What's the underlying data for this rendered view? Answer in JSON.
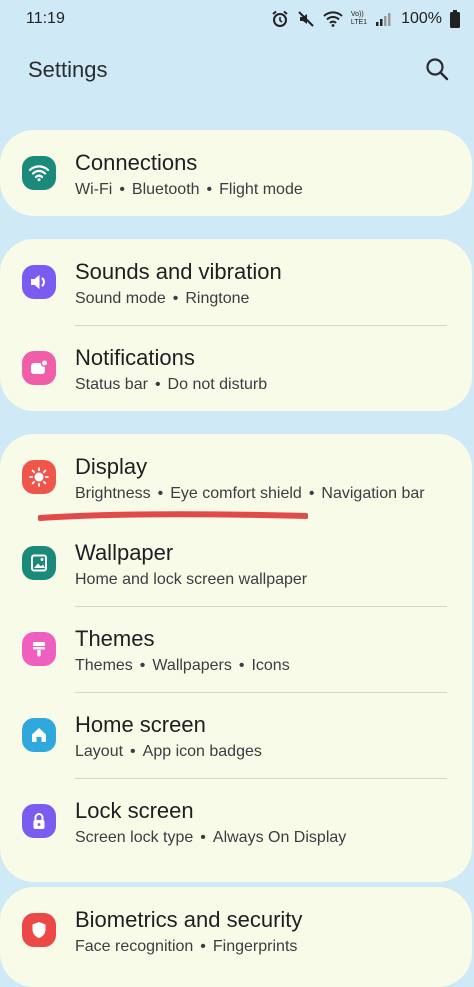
{
  "status_bar": {
    "time": "11:19",
    "battery": "100%",
    "icons": [
      "alarm-icon",
      "mute-icon",
      "wifi-icon",
      "volte-icon",
      "signal-icon",
      "battery-icon"
    ],
    "volte_label": "Vo))",
    "lte_label": "LTE1"
  },
  "header": {
    "title": "Settings",
    "search_icon": "search-icon"
  },
  "groups": [
    {
      "items": [
        {
          "title": "Connections",
          "subtitle": [
            "Wi-Fi",
            "Bluetooth",
            "Flight mode"
          ],
          "icon": "wifi-icon",
          "color": "#1b8a7a"
        }
      ]
    },
    {
      "items": [
        {
          "title": "Sounds and vibration",
          "subtitle": [
            "Sound mode",
            "Ringtone"
          ],
          "icon": "speaker-icon",
          "color": "#7b5cf0"
        },
        {
          "title": "Notifications",
          "subtitle": [
            "Status bar",
            "Do not disturb"
          ],
          "icon": "notification-icon",
          "color": "#f05ea8"
        }
      ]
    },
    {
      "items": [
        {
          "title": "Display",
          "subtitle": [
            "Brightness",
            "Eye comfort shield",
            "Navigation bar"
          ],
          "icon": "sun-icon",
          "color": "#f0554c"
        },
        {
          "title": "Wallpaper",
          "subtitle": [
            "Home and lock screen wallpaper"
          ],
          "icon": "image-icon",
          "color": "#1b8a7a"
        },
        {
          "title": "Themes",
          "subtitle": [
            "Themes",
            "Wallpapers",
            "Icons"
          ],
          "icon": "brush-icon",
          "color": "#ee5fc0"
        },
        {
          "title": "Home screen",
          "subtitle": [
            "Layout",
            "App icon badges"
          ],
          "icon": "home-icon",
          "color": "#2fa8dd"
        },
        {
          "title": "Lock screen",
          "subtitle": [
            "Screen lock type",
            "Always On Display"
          ],
          "icon": "lock-icon",
          "color": "#7b5cf0"
        }
      ]
    },
    {
      "items": [
        {
          "title": "Biometrics and security",
          "subtitle": [
            "Face recognition",
            "Fingerprints"
          ],
          "icon": "shield-icon",
          "color": "#ec4848"
        }
      ]
    }
  ],
  "separator": "•",
  "annotation": {
    "color": "#e24a4a"
  }
}
